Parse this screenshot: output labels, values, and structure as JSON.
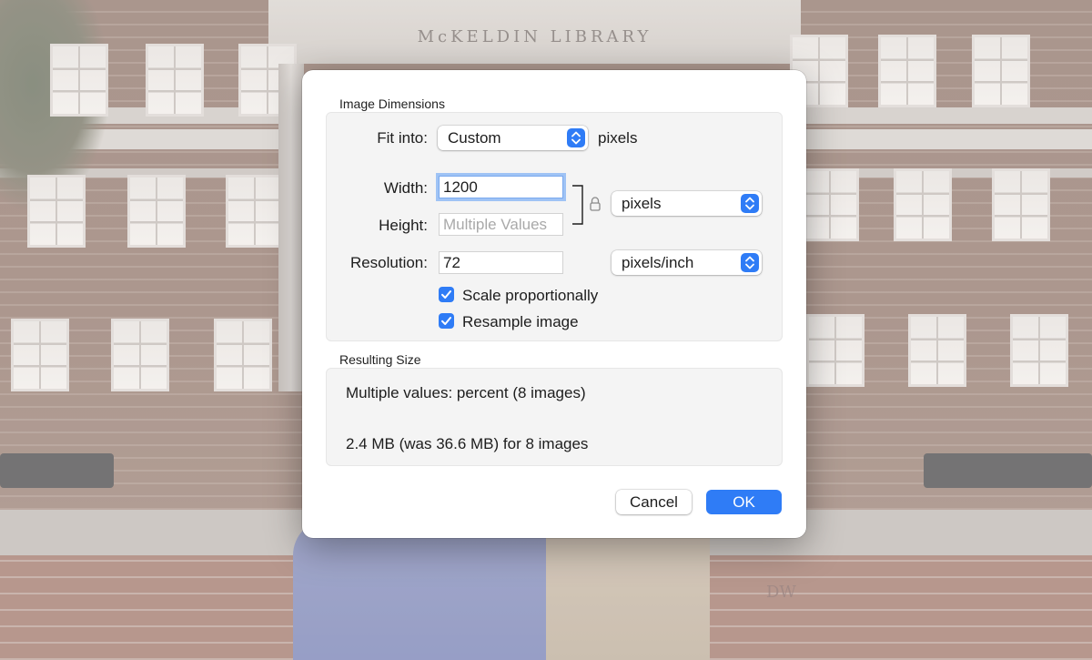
{
  "background": {
    "sign_text": "McKELDIN LIBRARY",
    "watermark": "DW"
  },
  "dialog": {
    "dimensions_title": "Image Dimensions",
    "fit_into": {
      "label": "Fit into:",
      "value": "Custom",
      "unit": "pixels"
    },
    "width": {
      "label": "Width:",
      "value": "1200"
    },
    "height": {
      "label": "Height:",
      "placeholder": "Multiple Values"
    },
    "size_unit": "pixels",
    "resolution": {
      "label": "Resolution:",
      "value": "72",
      "unit": "pixels/inch"
    },
    "scale_proportionally": {
      "label": "Scale proportionally",
      "checked": true
    },
    "resample_image": {
      "label": "Resample image",
      "checked": true
    },
    "resulting_title": "Resulting Size",
    "result_percent": "Multiple values: percent (8 images)",
    "result_size": "2.4 MB (was 36.6 MB) for 8 images",
    "cancel_label": "Cancel",
    "ok_label": "OK"
  },
  "colors": {
    "accent": "#2f7cf6",
    "focus_ring": "#9fc3f5"
  }
}
